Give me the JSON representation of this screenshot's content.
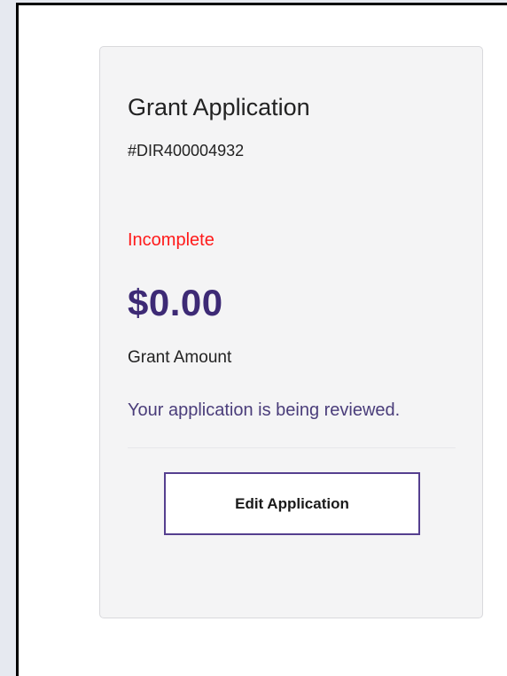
{
  "card": {
    "title": "Grant Application",
    "application_id": "#DIR400004932",
    "status": "Incomplete",
    "amount": "$0.00",
    "amount_label": "Grant Amount",
    "message": "Your application is being reviewed.",
    "edit_button_label": "Edit Application"
  },
  "colors": {
    "status": "#ff1a1a",
    "amount": "#3d2a75",
    "message": "#4a3d7a",
    "button_border": "#553f8f",
    "card_background": "#f4f4f5",
    "page_background": "#e6e9f0"
  }
}
